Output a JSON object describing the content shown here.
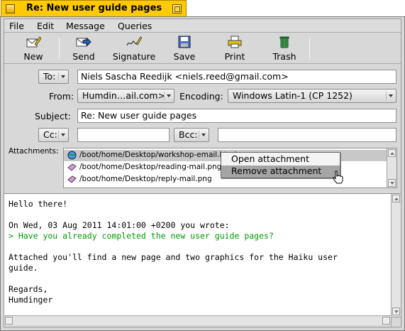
{
  "window": {
    "title": "Re: New user guide pages"
  },
  "menu": [
    "File",
    "Edit",
    "Message",
    "Queries"
  ],
  "toolbar": [
    {
      "label": "New",
      "icon": "new-mail-icon"
    },
    {
      "label": "Send",
      "icon": "send-icon"
    },
    {
      "label": "Signature",
      "icon": "signature-icon"
    },
    {
      "label": "Save",
      "icon": "save-icon"
    },
    {
      "label": "Print",
      "icon": "print-icon"
    },
    {
      "label": "Trash",
      "icon": "trash-icon"
    }
  ],
  "header": {
    "to_label": "To:",
    "to_value": "Niels Sascha Reedijk <niels.reed@gmail.com>",
    "from_label": "From:",
    "from_value": "Humdin…ail.com>",
    "encoding_label": "Encoding:",
    "encoding_value": "Windows Latin-1 (CP 1252)",
    "subject_label": "Subject:",
    "subject_value": "Re: New user guide pages",
    "cc_label": "Cc:",
    "cc_value": "",
    "bcc_label": "Bcc:",
    "bcc_value": "",
    "attachments_label": "Attachments:"
  },
  "attachments": [
    {
      "path": "/boot/home/Desktop/workshop-email.html",
      "selected": true
    },
    {
      "path": "/boot/home/Desktop/reading-mail.png",
      "selected": false
    },
    {
      "path": "/boot/home/Desktop/reply-mail.png",
      "selected": false
    }
  ],
  "context_menu": [
    {
      "label": "Open attachment",
      "highlighted": false
    },
    {
      "label": "Remove attachment",
      "highlighted": true
    }
  ],
  "body": {
    "greeting": "Hello there!",
    "quote_header": "On Wed, 03 Aug 2011 14:01:00 +0200 you wrote:",
    "quote": "> Have you already completed the new user guide pages?",
    "para_line1": "Attached you'll find a new page and two graphics for the Haiku user",
    "para_line2": "guide.",
    "closing": "Regards,",
    "signature": "Humdinger"
  },
  "colors": {
    "tab": "#ffcb00",
    "quote": "#009a00",
    "selection": "#a5a5a5"
  }
}
